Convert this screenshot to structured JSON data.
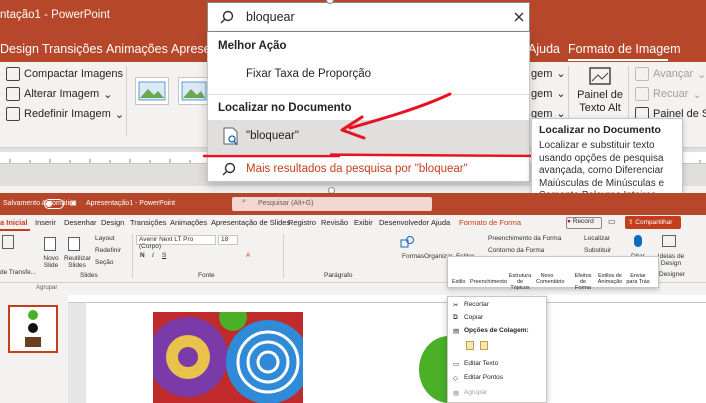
{
  "upper": {
    "title": "ntação1 - PowerPoint",
    "tabs": [
      "Design",
      "Transições",
      "Animações",
      "Apresen",
      "Ajuda",
      "Formato de Imagem"
    ],
    "ribbon": {
      "compactar": "Compactar Imagens",
      "alterar": "Alterar Imagem",
      "redefinir": "Redefinir Imagem",
      "painel_line1": "Painel de",
      "painel_line2": "Texto Alt",
      "avancar": "Avançar",
      "recuar": "Recuar",
      "painel_sel": "Painel de Sele",
      "opt1": "gem",
      "opt2": "gem",
      "opt3": "gem"
    }
  },
  "search": {
    "query": "bloquear",
    "section_best": "Melhor Ação",
    "best_action": "Fixar Taxa de Proporção",
    "section_doc": "Localizar no Documento",
    "doc_result": "\"bloquear\"",
    "more_results": "Mais resultados da pesquisa por \"bloquear\""
  },
  "tooltip": {
    "title": "Localizar no Documento",
    "desc": "Localizar e substituir texto usando opções de pesquisa avançada, como Diferenciar Maiúsculas de Minúsculas e Somente Palavras Inteiras."
  },
  "lower": {
    "autosave": "Salvamento Automático",
    "file": "Apresentação1 - PowerPoint",
    "search_placeholder": "Pesquisar (Alt+G)",
    "tabs": [
      "a Inicial",
      "Inserir",
      "Desenhar",
      "Design",
      "Transições",
      "Animações",
      "Apresentação de Slides",
      "Registro",
      "Revisão",
      "Exibir",
      "Desenvolvedor",
      "Ajuda",
      "Formato de Forma"
    ],
    "record": "Record",
    "share": "Compartilhar",
    "font_name": "Avenir Next LT Pro (Corpo)",
    "font_size": "18",
    "groups": {
      "slides": "Slides",
      "fonte": "Fonte",
      "paragrafo": "Parágrafo",
      "designer": "Designer"
    },
    "ribbon": {
      "layout": "Layout",
      "redefinir": "Redefinir",
      "secao": "Seção",
      "novo_slide": "Novo Slide",
      "reutilizar": "Reutilizar Slides",
      "formas": "Formas",
      "organizar": "Organizar",
      "estilos": "Estilos",
      "preenchimento": "Preenchimento da Forma",
      "contorno": "Contorno da Forma",
      "localizar": "Localizar",
      "substituir": "Substituir",
      "ditar": "Ditar",
      "ideias": "Ideias de Design",
      "transferencia": "de Transfe..."
    },
    "mini_toolbar": [
      "Estilo",
      "Preenchimento",
      "Estrutura de Tópicos",
      "Novo Comentário",
      "Efeitos de Forma",
      "Estilos de Animação",
      "Enviar para Trás"
    ],
    "context_menu": [
      "Recortar",
      "Copiar",
      "Opções de Colagem:",
      "Editar Texto",
      "Editar Pontos",
      "Agrupar"
    ],
    "qa_left": "Agrupar"
  }
}
